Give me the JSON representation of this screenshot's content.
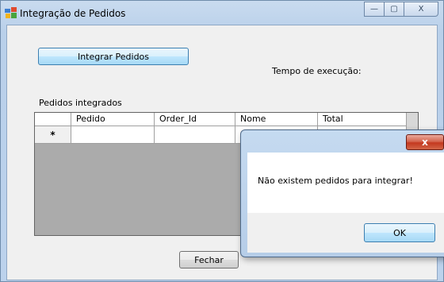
{
  "window": {
    "title": "Integração de Pedidos"
  },
  "buttons": {
    "integrate": "Integrar Pedidos",
    "close": "Fechar"
  },
  "labels": {
    "execution_time": "Tempo de execução:",
    "integrated_orders": "Pedidos integrados"
  },
  "grid": {
    "columns": [
      "Pedido",
      "Order_Id",
      "Nome",
      "Total"
    ],
    "new_row_marker": "*"
  },
  "dialog": {
    "message": "Não existem pedidos para integrar!",
    "ok": "OK",
    "close_glyph": "x"
  },
  "caption_buttons": {
    "minimize": "—",
    "maximize": "▢",
    "close": "X"
  }
}
